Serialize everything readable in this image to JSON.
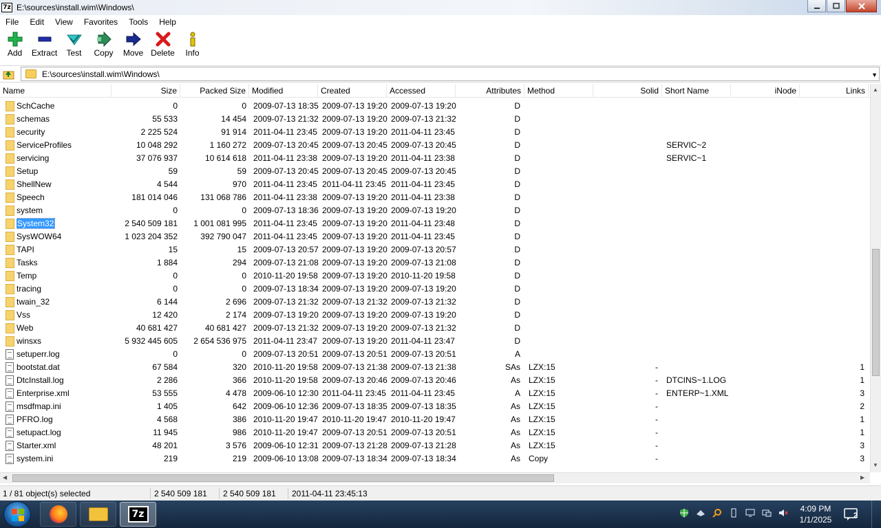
{
  "window": {
    "title": "E:\\sources\\install.wim\\Windows\\",
    "app_icon_text": "7z"
  },
  "menu": [
    "File",
    "Edit",
    "View",
    "Favorites",
    "Tools",
    "Help"
  ],
  "toolbar": [
    {
      "label": "Add",
      "icon": "add-icon"
    },
    {
      "label": "Extract",
      "icon": "extract-icon"
    },
    {
      "label": "Test",
      "icon": "test-icon"
    },
    {
      "label": "Copy",
      "icon": "copy-icon"
    },
    {
      "label": "Move",
      "icon": "move-icon"
    },
    {
      "label": "Delete",
      "icon": "delete-icon"
    },
    {
      "label": "Info",
      "icon": "info-icon"
    }
  ],
  "address": {
    "path": "E:\\sources\\install.wim\\Windows\\"
  },
  "columns": [
    "Name",
    "Size",
    "Packed Size",
    "Modified",
    "Created",
    "Accessed",
    "Attributes",
    "Method",
    "Solid",
    "Short Name",
    "iNode",
    "Links"
  ],
  "rows": [
    {
      "type": "folder",
      "name": "SchCache",
      "size": "0",
      "packed": "0",
      "modified": "2009-07-13 18:35",
      "created": "2009-07-13 19:20",
      "accessed": "2009-07-13 19:20",
      "attr": "D",
      "method": "",
      "solid": "",
      "short": "",
      "links": ""
    },
    {
      "type": "folder",
      "name": "schemas",
      "size": "55 533",
      "packed": "14 454",
      "modified": "2009-07-13 21:32",
      "created": "2009-07-13 19:20",
      "accessed": "2009-07-13 21:32",
      "attr": "D",
      "method": "",
      "solid": "",
      "short": "",
      "links": ""
    },
    {
      "type": "folder",
      "name": "security",
      "size": "2 225 524",
      "packed": "91 914",
      "modified": "2011-04-11 23:45",
      "created": "2009-07-13 19:20",
      "accessed": "2011-04-11 23:45",
      "attr": "D",
      "method": "",
      "solid": "",
      "short": "",
      "links": ""
    },
    {
      "type": "folder",
      "name": "ServiceProfiles",
      "size": "10 048 292",
      "packed": "1 160 272",
      "modified": "2009-07-13 20:45",
      "created": "2009-07-13 20:45",
      "accessed": "2009-07-13 20:45",
      "attr": "D",
      "method": "",
      "solid": "",
      "short": "SERVIC~2",
      "links": ""
    },
    {
      "type": "folder",
      "name": "servicing",
      "size": "37 076 937",
      "packed": "10 614 618",
      "modified": "2011-04-11 23:38",
      "created": "2009-07-13 19:20",
      "accessed": "2011-04-11 23:38",
      "attr": "D",
      "method": "",
      "solid": "",
      "short": "SERVIC~1",
      "links": ""
    },
    {
      "type": "folder",
      "name": "Setup",
      "size": "59",
      "packed": "59",
      "modified": "2009-07-13 20:45",
      "created": "2009-07-13 20:45",
      "accessed": "2009-07-13 20:45",
      "attr": "D",
      "method": "",
      "solid": "",
      "short": "",
      "links": ""
    },
    {
      "type": "folder",
      "name": "ShellNew",
      "size": "4 544",
      "packed": "970",
      "modified": "2011-04-11 23:45",
      "created": "2011-04-11 23:45",
      "accessed": "2011-04-11 23:45",
      "attr": "D",
      "method": "",
      "solid": "",
      "short": "",
      "links": ""
    },
    {
      "type": "folder",
      "name": "Speech",
      "size": "181 014 046",
      "packed": "131 068 786",
      "modified": "2011-04-11 23:38",
      "created": "2009-07-13 19:20",
      "accessed": "2011-04-11 23:38",
      "attr": "D",
      "method": "",
      "solid": "",
      "short": "",
      "links": ""
    },
    {
      "type": "folder",
      "name": "system",
      "size": "0",
      "packed": "0",
      "modified": "2009-07-13 18:36",
      "created": "2009-07-13 19:20",
      "accessed": "2009-07-13 19:20",
      "attr": "D",
      "method": "",
      "solid": "",
      "short": "",
      "links": ""
    },
    {
      "type": "folder",
      "name": "System32",
      "size": "2 540 509 181",
      "packed": "1 001 081 995",
      "modified": "2011-04-11 23:45",
      "created": "2009-07-13 19:20",
      "accessed": "2011-04-11 23:48",
      "attr": "D",
      "method": "",
      "solid": "",
      "short": "",
      "links": "",
      "selected": true
    },
    {
      "type": "folder",
      "name": "SysWOW64",
      "size": "1 023 204 352",
      "packed": "392 790 047",
      "modified": "2011-04-11 23:45",
      "created": "2009-07-13 19:20",
      "accessed": "2011-04-11 23:45",
      "attr": "D",
      "method": "",
      "solid": "",
      "short": "",
      "links": ""
    },
    {
      "type": "folder",
      "name": "TAPI",
      "size": "15",
      "packed": "15",
      "modified": "2009-07-13 20:57",
      "created": "2009-07-13 19:20",
      "accessed": "2009-07-13 20:57",
      "attr": "D",
      "method": "",
      "solid": "",
      "short": "",
      "links": ""
    },
    {
      "type": "folder",
      "name": "Tasks",
      "size": "1 884",
      "packed": "294",
      "modified": "2009-07-13 21:08",
      "created": "2009-07-13 19:20",
      "accessed": "2009-07-13 21:08",
      "attr": "D",
      "method": "",
      "solid": "",
      "short": "",
      "links": ""
    },
    {
      "type": "folder",
      "name": "Temp",
      "size": "0",
      "packed": "0",
      "modified": "2010-11-20 19:58",
      "created": "2009-07-13 19:20",
      "accessed": "2010-11-20 19:58",
      "attr": "D",
      "method": "",
      "solid": "",
      "short": "",
      "links": ""
    },
    {
      "type": "folder",
      "name": "tracing",
      "size": "0",
      "packed": "0",
      "modified": "2009-07-13 18:34",
      "created": "2009-07-13 19:20",
      "accessed": "2009-07-13 19:20",
      "attr": "D",
      "method": "",
      "solid": "",
      "short": "",
      "links": ""
    },
    {
      "type": "folder",
      "name": "twain_32",
      "size": "6 144",
      "packed": "2 696",
      "modified": "2009-07-13 21:32",
      "created": "2009-07-13 21:32",
      "accessed": "2009-07-13 21:32",
      "attr": "D",
      "method": "",
      "solid": "",
      "short": "",
      "links": ""
    },
    {
      "type": "folder",
      "name": "Vss",
      "size": "12 420",
      "packed": "2 174",
      "modified": "2009-07-13 19:20",
      "created": "2009-07-13 19:20",
      "accessed": "2009-07-13 19:20",
      "attr": "D",
      "method": "",
      "solid": "",
      "short": "",
      "links": ""
    },
    {
      "type": "folder",
      "name": "Web",
      "size": "40 681 427",
      "packed": "40 681 427",
      "modified": "2009-07-13 21:32",
      "created": "2009-07-13 19:20",
      "accessed": "2009-07-13 21:32",
      "attr": "D",
      "method": "",
      "solid": "",
      "short": "",
      "links": ""
    },
    {
      "type": "folder",
      "name": "winsxs",
      "size": "5 932 445 605",
      "packed": "2 654 536 975",
      "modified": "2011-04-11 23:47",
      "created": "2009-07-13 19:20",
      "accessed": "2011-04-11 23:47",
      "attr": "D",
      "method": "",
      "solid": "",
      "short": "",
      "links": ""
    },
    {
      "type": "file",
      "name": "setuperr.log",
      "size": "0",
      "packed": "0",
      "modified": "2009-07-13 20:51",
      "created": "2009-07-13 20:51",
      "accessed": "2009-07-13 20:51",
      "attr": "A",
      "method": "",
      "solid": "",
      "short": "",
      "links": ""
    },
    {
      "type": "file",
      "name": "bootstat.dat",
      "size": "67 584",
      "packed": "320",
      "modified": "2010-11-20 19:58",
      "created": "2009-07-13 21:38",
      "accessed": "2009-07-13 21:38",
      "attr": "SAs",
      "method": "LZX:15",
      "solid": "-",
      "short": "",
      "links": "1"
    },
    {
      "type": "file",
      "name": "DtcInstall.log",
      "size": "2 286",
      "packed": "366",
      "modified": "2010-11-20 19:58",
      "created": "2009-07-13 20:46",
      "accessed": "2009-07-13 20:46",
      "attr": "As",
      "method": "LZX:15",
      "solid": "-",
      "short": "DTCINS~1.LOG",
      "links": "1"
    },
    {
      "type": "file",
      "name": "Enterprise.xml",
      "size": "53 555",
      "packed": "4 478",
      "modified": "2009-06-10 12:30",
      "created": "2011-04-11 23:45",
      "accessed": "2011-04-11 23:45",
      "attr": "A",
      "method": "LZX:15",
      "solid": "-",
      "short": "ENTERP~1.XML",
      "links": "3"
    },
    {
      "type": "file",
      "name": "msdfmap.ini",
      "size": "1 405",
      "packed": "642",
      "modified": "2009-06-10 12:36",
      "created": "2009-07-13 18:35",
      "accessed": "2009-07-13 18:35",
      "attr": "As",
      "method": "LZX:15",
      "solid": "-",
      "short": "",
      "links": "2"
    },
    {
      "type": "file",
      "name": "PFRO.log",
      "size": "4 568",
      "packed": "386",
      "modified": "2010-11-20 19:47",
      "created": "2010-11-20 19:47",
      "accessed": "2010-11-20 19:47",
      "attr": "As",
      "method": "LZX:15",
      "solid": "-",
      "short": "",
      "links": "1"
    },
    {
      "type": "file",
      "name": "setupact.log",
      "size": "11 945",
      "packed": "986",
      "modified": "2010-11-20 19:47",
      "created": "2009-07-13 20:51",
      "accessed": "2009-07-13 20:51",
      "attr": "As",
      "method": "LZX:15",
      "solid": "-",
      "short": "",
      "links": "1"
    },
    {
      "type": "file",
      "name": "Starter.xml",
      "size": "48 201",
      "packed": "3 576",
      "modified": "2009-06-10 12:31",
      "created": "2009-07-13 21:28",
      "accessed": "2009-07-13 21:28",
      "attr": "As",
      "method": "LZX:15",
      "solid": "-",
      "short": "",
      "links": "3"
    },
    {
      "type": "file",
      "name": "system.ini",
      "size": "219",
      "packed": "219",
      "modified": "2009-06-10 13:08",
      "created": "2009-07-13 18:34",
      "accessed": "2009-07-13 18:34",
      "attr": "As",
      "method": "Copy",
      "solid": "-",
      "short": "",
      "links": "3"
    }
  ],
  "status": {
    "selection": "1 / 81 object(s) selected",
    "size": "2 540 509 181",
    "packed": "2 540 509 181",
    "modified": "2011-04-11 23:45:13"
  },
  "taskbar": {
    "apps": [
      {
        "name": "firefox",
        "icon": "firefox-icon"
      },
      {
        "name": "file-explorer",
        "icon": "folder-icon"
      },
      {
        "name": "7-zip",
        "icon": "7zip-icon",
        "text": "7z",
        "active": true
      }
    ],
    "tray_icons": [
      "shield-icon",
      "network-icon",
      "search-icon",
      "usb-icon",
      "display-icon",
      "monitor-icon",
      "volume-muted-icon"
    ],
    "time": "4:09 PM",
    "date": "1/1/2025",
    "notifications": "2"
  },
  "colors": {
    "selection": "#3399ff",
    "folder": "#f6d36e",
    "taskbar": "#1c3350",
    "close_button": "#c4462c"
  }
}
